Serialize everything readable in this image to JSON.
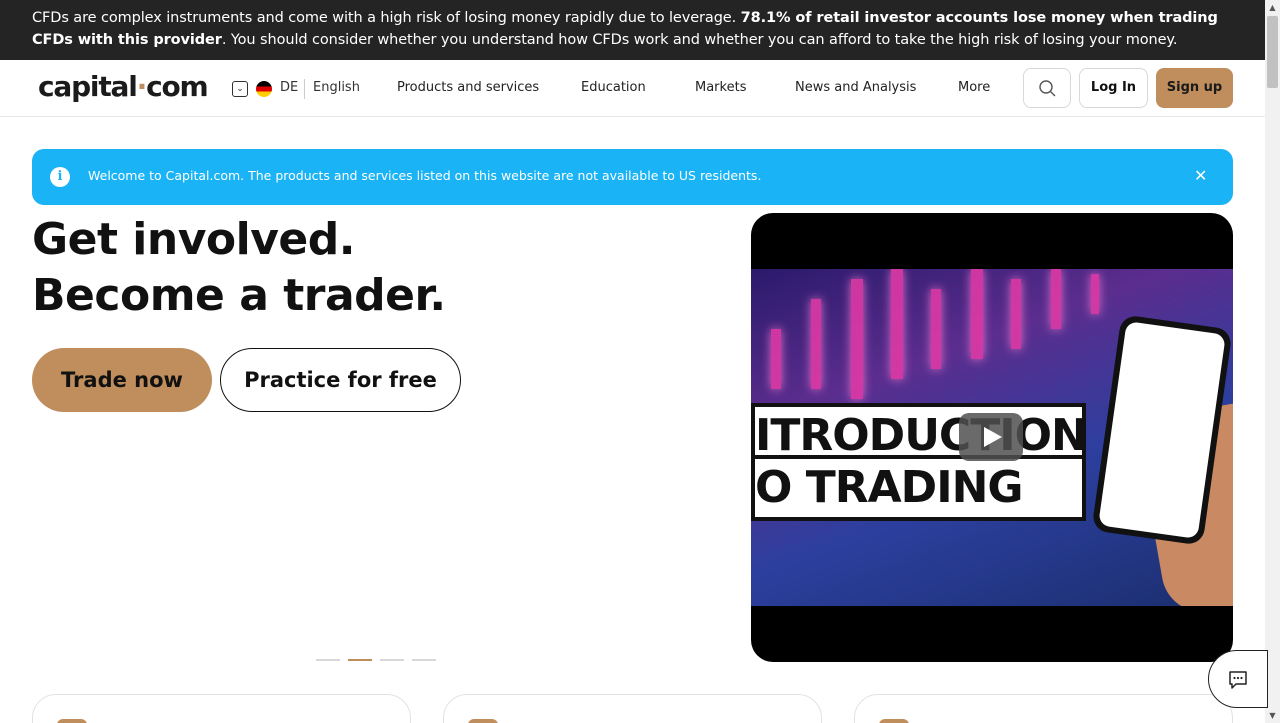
{
  "risk_warning": {
    "text_1": "CFDs are complex instruments and come with a high risk of losing money rapidly due to leverage. ",
    "bold": "78.1% of retail investor accounts lose money when trading CFDs with this provider",
    "text_2": ". You should consider whether you understand how CFDs work and whether you can afford to take the high risk of losing your money."
  },
  "header": {
    "logo_left": "capital",
    "logo_dot": "·",
    "logo_right": "com",
    "lang_code": "DE",
    "lang_name": "English",
    "nav": [
      "Products and services",
      "Education",
      "Markets",
      "News and Analysis",
      "More"
    ],
    "login_label": "Log In",
    "signup_label": "Sign up"
  },
  "notice": {
    "icon": "i",
    "text": "Welcome to Capital.com. The products and services listed on this website are not available to US residents.",
    "close": "✕"
  },
  "hero": {
    "line_1": "Get involved.",
    "line_2": "Become a trader.",
    "primary_cta": "Trade now",
    "secondary_cta": "Practice for free"
  },
  "video": {
    "title_line_1": "ITRODUCTION",
    "title_line_2": "O TRADING"
  },
  "carousel": {
    "slides": 4,
    "active_index": 1
  },
  "colors": {
    "accent": "#c08e5c",
    "notice": "#1ab3f5",
    "banner": "#242424"
  }
}
